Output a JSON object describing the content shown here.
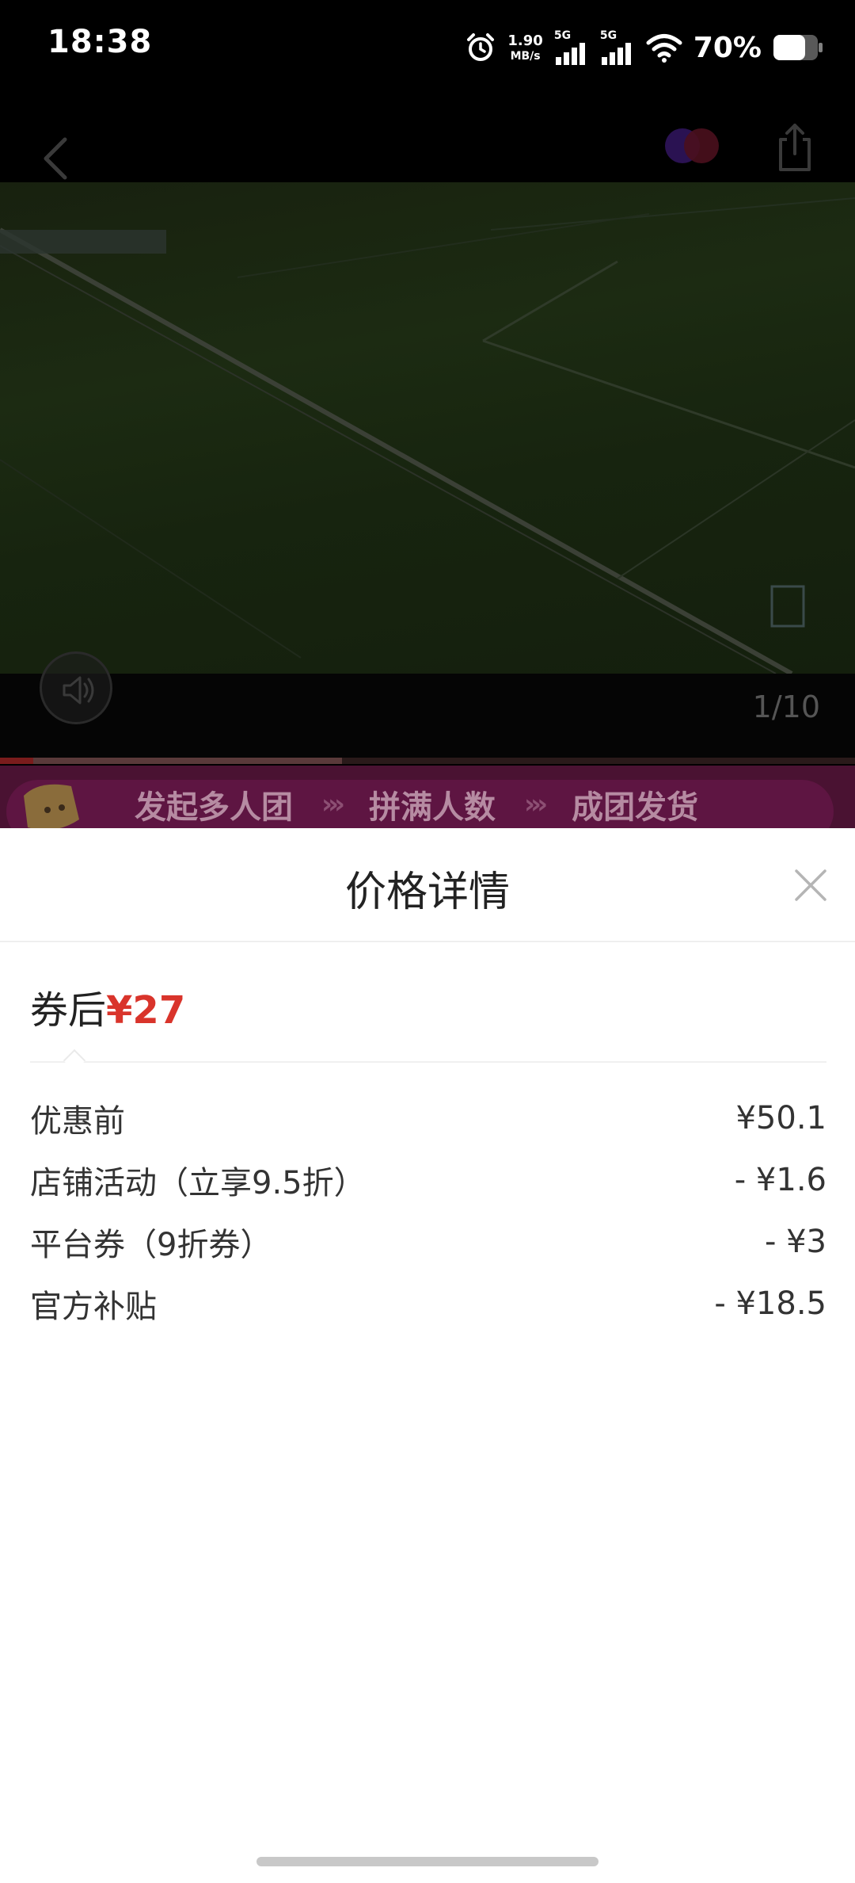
{
  "status_bar": {
    "time": "18:38",
    "net_speed_value": "1.90",
    "net_speed_unit": "MB/s",
    "sim1_label": "5G",
    "sim2_label": "5G",
    "battery": "70%"
  },
  "media": {
    "page_counter": "1/10",
    "progress_fraction": 0.4
  },
  "group_banner": {
    "steps": [
      "发起多人团",
      "拼满人数",
      "成团发货"
    ]
  },
  "sheet": {
    "title": "价格详情",
    "final_price_label": "券后",
    "final_price_value": "¥27",
    "rows": [
      {
        "label": "优惠前",
        "value": "¥50.1"
      },
      {
        "label": "店铺活动（立享9.5折）",
        "value": "- ¥1.6"
      },
      {
        "label": "平台券（9折券）",
        "value": "- ¥3"
      },
      {
        "label": "官方补贴",
        "value": "- ¥18.5"
      }
    ]
  },
  "colors": {
    "price_red": "#d9342b",
    "banner_magenta": "#5e1542"
  },
  "icons": [
    "alarm-icon",
    "signal-icon",
    "wifi-icon",
    "battery-icon",
    "back-icon",
    "brand-logo",
    "share-icon",
    "sound-icon",
    "close-icon"
  ]
}
